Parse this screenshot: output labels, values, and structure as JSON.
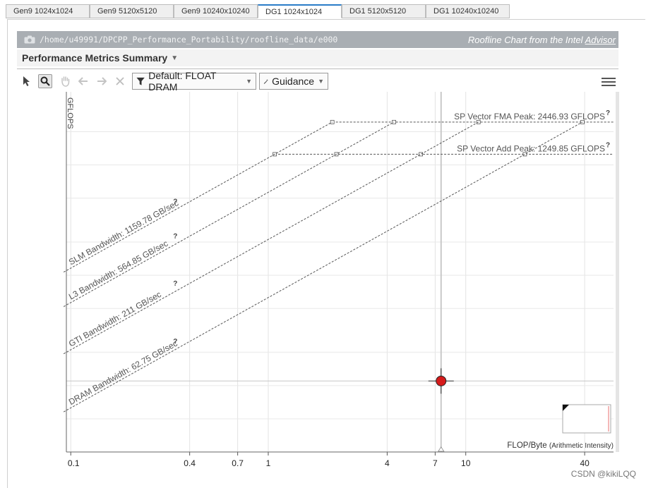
{
  "tabs": [
    {
      "label": "Gen9 1024x1024",
      "active": false
    },
    {
      "label": "Gen9 5120x5120",
      "active": false
    },
    {
      "label": "Gen9 10240x10240",
      "active": false
    },
    {
      "label": "DG1 1024x1024",
      "active": true
    },
    {
      "label": "DG1 5120x5120",
      "active": false
    },
    {
      "label": "DG1 10240x10240",
      "active": false
    }
  ],
  "header": {
    "path": "/home/u49991/DPCPP_Performance_Portability/roofline_data/e000",
    "title_prefix": "Roofline Chart from the Intel",
    "title_link": "Advisor"
  },
  "summary": {
    "label": "Performance Metrics Summary"
  },
  "toolbar": {
    "filter_label": "Default: FLOAT DRAM",
    "guidance_label": "Guidance",
    "icons": [
      "pointer-icon",
      "zoom-icon",
      "pan-icon",
      "undo-icon",
      "redo-icon",
      "reset-icon",
      "filter-icon",
      "wand-icon",
      "menu-icon"
    ]
  },
  "chart_data": {
    "type": "scatter",
    "ylabel": "GFLOPS",
    "xlabel_main": "FLOP/Byte",
    "xlabel_sub": "(Arithmetic Intensity)",
    "x_scale": "log",
    "y_scale": "log",
    "grid": true,
    "x_ticks": [
      "0.1",
      "0.4",
      "0.7",
      "1",
      "4",
      "7",
      "10",
      "40"
    ],
    "roofs": [
      {
        "label": "SP Vector FMA Peak: 2446.93 GFLOPS",
        "value": 2446.93
      },
      {
        "label": "SP Vector Add Peak: 1249.85 GFLOPS",
        "value": 1249.85
      }
    ],
    "bandwidths": [
      {
        "label": "SLM Bandwidth: 1159.78 GB/sec",
        "value": 1159.78
      },
      {
        "label": "L3 Bandwidth: 564.85 GB/sec",
        "value": 564.85
      },
      {
        "label": "GTI Bandwidth: 211 GB/sec",
        "value": 211
      },
      {
        "label": "DRAM Bandwidth: 62.75 GB/sec",
        "value": 62.75
      }
    ],
    "points": [
      {
        "x": 7.5,
        "y": 11,
        "color": "#d61b1b"
      }
    ],
    "help_mark": "?"
  },
  "watermark": "CSDN @kikiLQQ"
}
